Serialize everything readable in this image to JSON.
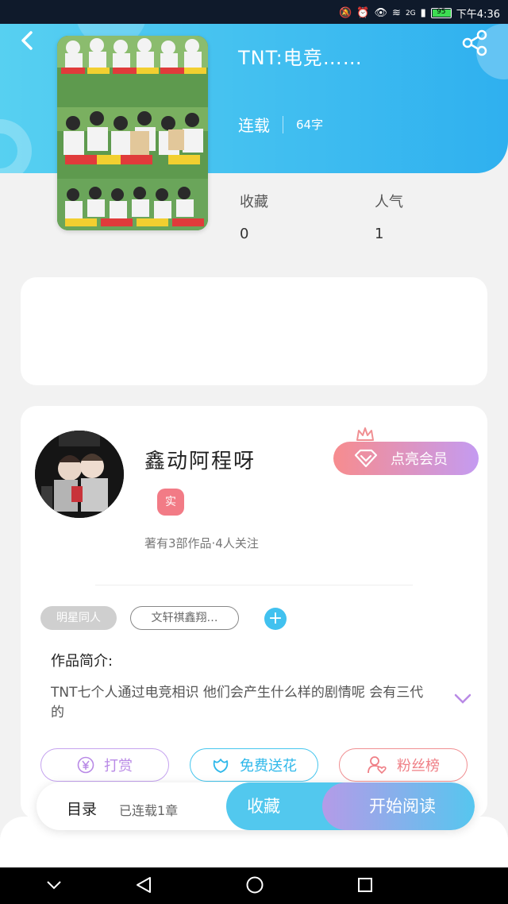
{
  "status_bar": {
    "network": "2G",
    "battery": "95",
    "time": "下午4:36"
  },
  "header": {
    "title": "TNT:电竞……",
    "serial_status": "连载",
    "word_count": "64字"
  },
  "stats": {
    "favorites_label": "收藏",
    "favorites_value": "0",
    "popularity_label": "人气",
    "popularity_value": "1"
  },
  "author": {
    "name": "鑫动阿程呀",
    "real_badge": "实",
    "meta": "著有3部作品·4人关注",
    "vip_button": "点亮会员"
  },
  "tags": {
    "tag1": "明星同人",
    "tag2": "文轩祺鑫翔…"
  },
  "intro": {
    "title": "作品简介:",
    "text": "TNT七个人通过电竞相识 他们会产生什么样的剧情呢 会有三代的"
  },
  "actions": {
    "reward": "打赏",
    "flowers": "免费送花",
    "fans": "粉丝榜"
  },
  "bottom_bar": {
    "toc": "目录",
    "chapter_count": "已连载1章",
    "collect": "收藏",
    "read": "开始阅读"
  },
  "colors": {
    "header_blue": "#2fb0ef",
    "accent_pink": "#f27b86",
    "accent_purple": "#b98ae6"
  }
}
